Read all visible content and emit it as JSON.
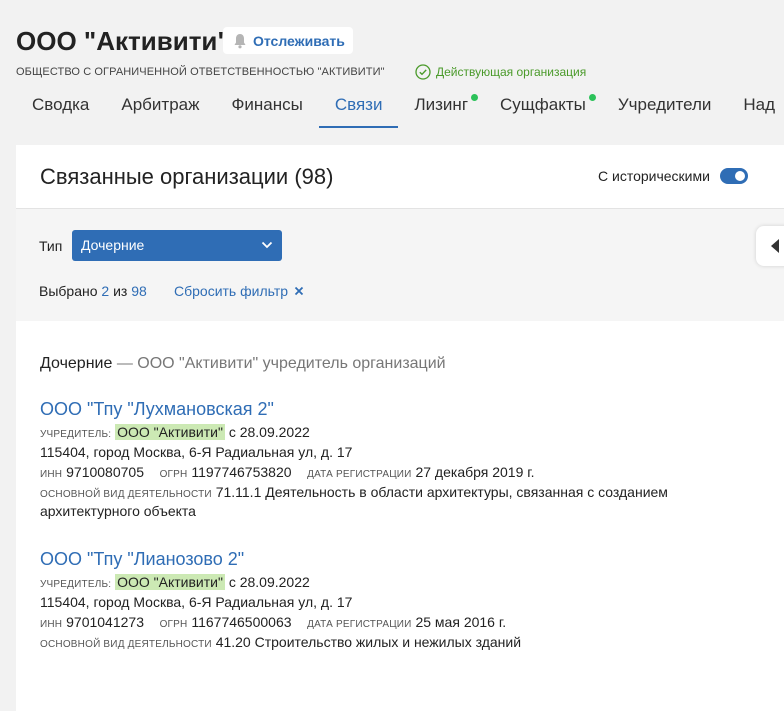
{
  "header": {
    "title": "ООО \"Активити\"",
    "follow_label": "Отслеживать",
    "full_name": "ОБЩЕСТВО С ОГРАНИЧЕННОЙ ОТВЕТСТВЕННОСТЬЮ \"АКТИВИТИ\"",
    "status": "Действующая организация"
  },
  "tabs": [
    {
      "label": "Сводка"
    },
    {
      "label": "Арбитраж"
    },
    {
      "label": "Финансы"
    },
    {
      "label": "Связи"
    },
    {
      "label": "Лизинг"
    },
    {
      "label": "Сущфакты"
    },
    {
      "label": "Учредители"
    },
    {
      "label": "Над"
    }
  ],
  "panel": {
    "title": "Связанные организации (98)",
    "historical_label": "С историческими"
  },
  "filter": {
    "type_label": "Тип",
    "type_value": "Дочерние",
    "selected_prefix": "Выбрано",
    "selected_count": "2",
    "selected_of": "из",
    "selected_total": "98",
    "reset_label": "Сбросить фильтр"
  },
  "section": {
    "name": "Дочерние",
    "desc": "— ООО \"Активити\" учредитель организаций"
  },
  "orgs": [
    {
      "name": "ООО \"Тпу \"Лухмановская 2\"",
      "founder_caption": "учредитель:",
      "founder": "ООО \"Активити\"",
      "founder_since": "с 28.09.2022",
      "address": "115404, город Москва, 6-Я Радиальная ул, д. 17",
      "inn_caption": "инн",
      "inn": "9710080705",
      "ogrn_caption": "огрн",
      "ogrn": "1197746753820",
      "reg_caption": "дата регистрации",
      "reg_date": "27 декабря 2019 г.",
      "activity_caption": "основной вид деятельности",
      "activity": "71.11.1 Деятельность в области архитектуры, связанная с созданием архитектурного объекта"
    },
    {
      "name": "ООО \"Тпу \"Лианозово 2\"",
      "founder_caption": "учредитель:",
      "founder": "ООО \"Активити\"",
      "founder_since": "с 28.09.2022",
      "address": "115404, город Москва, 6-Я Радиальная ул, д. 17",
      "inn_caption": "инн",
      "inn": "9701041273",
      "ogrn_caption": "огрн",
      "ogrn": "1167746500063",
      "reg_caption": "дата регистрации",
      "reg_date": "25 мая 2016 г.",
      "activity_caption": "основной вид деятельности",
      "activity": "41.20 Строительство жилых и нежилых зданий"
    }
  ],
  "colors": {
    "accent": "#2f6db5",
    "active_status": "#4a9a2a",
    "tab_dot": "#2cc25a",
    "highlight": "#cce9b4"
  },
  "icons": {
    "follow": "bell-icon",
    "status": "check-circle-icon",
    "select": "chevron-down-icon",
    "reset": "close-icon",
    "collapse": "chevron-left-icon"
  }
}
